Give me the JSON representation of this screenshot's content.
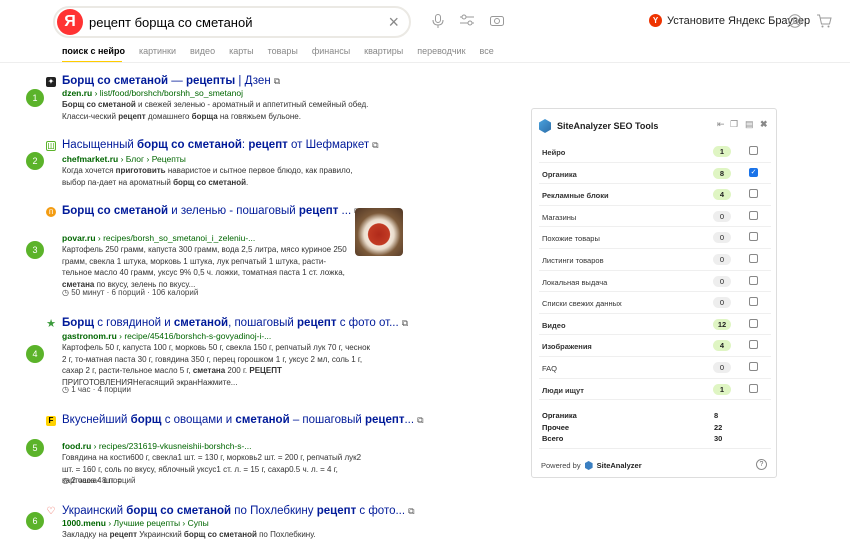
{
  "header": {
    "logo_letter": "Я",
    "query": "рецепт борща со сметаной",
    "clear_icon": "×",
    "promo_text": "Установите Яндекс Браузер",
    "promo_logo": "Y"
  },
  "tabs": [
    "поиск с нейро",
    "картинки",
    "видео",
    "карты",
    "товары",
    "финансы",
    "квартиры",
    "переводчик",
    "все"
  ],
  "results": [
    {
      "n": "1",
      "title_html": "<b>Борщ со сметаной</b> — <b>рецепты</b> | Дзен",
      "url_html": "<b>dzen.ru</b> › list/food/borshch/borshh_so_smetanoj",
      "snippet_html": "<b>Борщ со сметаной</b> и свежей зеленью - ароматный и аппетитный семейный обед. Класси-ческий <b>рецепт</b> домашнего <b>борща</b> на говяжьем бульоне."
    },
    {
      "n": "2",
      "title_html": "Насыщенный <b>борщ со сметаной</b>: <b>рецепт</b> от Шефмаркет",
      "url_html": "<b>chefmarket.ru</b> › Блог › Рецепты",
      "snippet_html": "Когда хочется <b>приготовить</b> наваристое и сытное первое блюдо, как правило, выбор па-дает на ароматный <b>борщ со сметаной</b>."
    },
    {
      "n": "3",
      "title_html": "<b>Борщ со сметаной</b> и зеленью - пошаговый <b>рецепт</b> ...",
      "url_html": "<b>povar.ru</b> › recipes/borsh_so_smetanoi_i_zeleniu-...",
      "snippet_html": "Картофель 250 грамм, капуста 300 грамм, вода 2,5 литра, мясо куриное 250 грамм, свекла 1 штука, морковь 1 штука, лук репчатый 1 штука, расти-тельное масло 40 грамм, уксус 9% 0,5 ч. ложки, томатная паста 1 ст. ложка, <b>сметана</b> по вкусу, зелень по вкусу...",
      "meta": "◷ 50 минут · 6 порций · 106 калорий"
    },
    {
      "n": "4",
      "title_html": "<b>Борщ</b> с говядиной и <b>сметаной</b>, пошаговый <b>рецепт</b> с фото от...",
      "url_html": "<b>gastronom.ru</b> › recipe/45416/borshch-s-govyadinoj-i-...",
      "snippet_html": "Картофель 50 г, капуста 100 г, морковь 50 г, свекла 150 г, репчатый лук 70 г, чеснок 2 г, то-матная паста 30 г, говядина 350 г, перец горошком 1 г, уксус 2 мл, соль 1 г, сахар 2 г, расти-тельное масло 5 г, <b>сметана</b> 200 г. <b>РЕЦЕПТ</b> ПРИГОТОВЛЕНИЯНегасящий экранНажмите...",
      "meta": "◷ 1 час · 4 порции"
    },
    {
      "n": "5",
      "title_html": "Вкуснейший <b>борщ</b> с овощами и <b>сметаной</b> – пошаговый <b>рецепт</b>...",
      "url_html": "<b>food.ru</b> › recipes/231619-vkusneishii-borshch-s-...",
      "snippet_html": "Говядина на кости600 г, свекла1 шт. = 130 г, морковь2 шт. = 200 г, репчатый лук2 шт. = 160 г, соль по вкусу, яблочный уксус1 ст. л. = 15 г, сахар0.5 ч. л. = 4 г, картошка4 шт. =",
      "meta": "◷ 2 часа · 8 порций"
    },
    {
      "n": "6",
      "title_html": "Украинский <b>борщ со сметаной</b> по Похлебкину <b>рецепт</b> с фото...",
      "url_html": "<b>1000.menu</b> › Лучшие рецепты › Супы",
      "snippet_html": "Закладку на <b>рецепт</b> Украинский <b>борщ со сметаной</b> по Похлебкину."
    }
  ],
  "panel": {
    "title": "SiteAnalyzer SEO Tools",
    "rows": [
      {
        "label": "Нейро",
        "value": "1",
        "bold": true,
        "nonzero": true,
        "checked": false
      },
      {
        "label": "Органика",
        "value": "8",
        "bold": true,
        "nonzero": true,
        "checked": true
      },
      {
        "label": "Рекламные блоки",
        "value": "4",
        "bold": true,
        "nonzero": true,
        "checked": false
      },
      {
        "label": "Магазины",
        "value": "0",
        "bold": false,
        "nonzero": false,
        "checked": false
      },
      {
        "label": "Похожие товары",
        "value": "0",
        "bold": false,
        "nonzero": false,
        "checked": false
      },
      {
        "label": "Листинги товаров",
        "value": "0",
        "bold": false,
        "nonzero": false,
        "checked": false
      },
      {
        "label": "Локальная выдача",
        "value": "0",
        "bold": false,
        "nonzero": false,
        "checked": false
      },
      {
        "label": "Списки свежих данных",
        "value": "0",
        "bold": false,
        "nonzero": false,
        "checked": false
      },
      {
        "label": "Видео",
        "value": "12",
        "bold": true,
        "nonzero": true,
        "checked": false
      },
      {
        "label": "Изображения",
        "value": "4",
        "bold": true,
        "nonzero": true,
        "checked": false
      },
      {
        "label": "FAQ",
        "value": "0",
        "bold": false,
        "nonzero": false,
        "checked": false
      },
      {
        "label": "Люди ищут",
        "value": "1",
        "bold": true,
        "nonzero": true,
        "checked": false
      }
    ],
    "totals": [
      {
        "label": "Органика",
        "value": "8"
      },
      {
        "label": "Прочее",
        "value": "22"
      },
      {
        "label": "Всего",
        "value": "30"
      }
    ],
    "footer_prefix": "Powered by",
    "footer_brand": "SiteAnalyzer",
    "help": "?"
  },
  "colors": {
    "link": "#001a99",
    "url": "#006600",
    "badge": "#5bb32a",
    "brand_red": "#ff3333",
    "tab_accent": "#ffcc00"
  }
}
